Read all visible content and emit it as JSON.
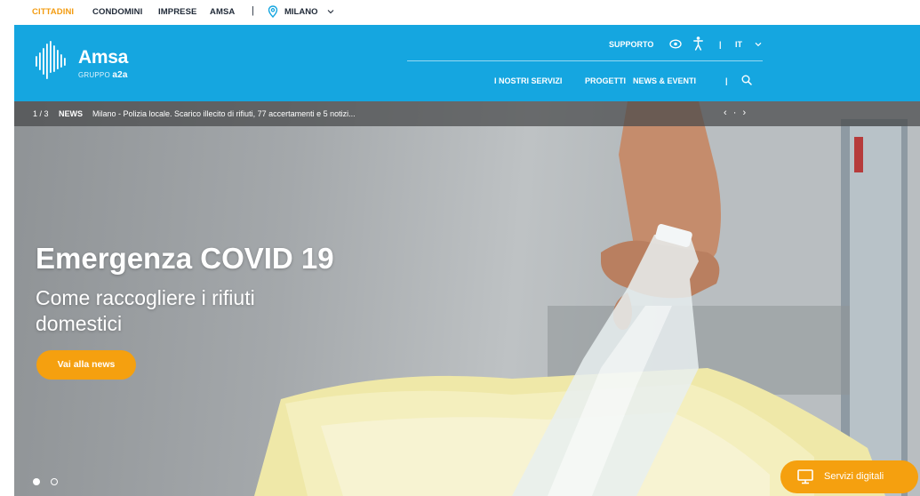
{
  "utility_nav": {
    "items": [
      {
        "label": "CITTADINI",
        "active": true
      },
      {
        "label": "CONDOMINI",
        "active": false
      },
      {
        "label": "IMPRESE",
        "active": false
      },
      {
        "label": "AMSA",
        "active": false
      }
    ],
    "separator": "|",
    "city": "MILANO"
  },
  "header": {
    "logo_word": "Amsa",
    "logo_sub_prefix": "GRUPPO",
    "logo_sub_brand": "a2a",
    "support_label": "SUPPORTO",
    "separator": "|",
    "language": "IT",
    "nav": [
      "I NOSTRI SERVIZI",
      "PROGETTI",
      "NEWS & EVENTI"
    ]
  },
  "news_ticker": {
    "counter": "1 / 3",
    "tag": "NEWS",
    "text": "Milano - Polizia locale. Scarico illecito di rifiuti, 77 accertamenti e 5 notizi...",
    "arrows": "‹ · ›"
  },
  "hero": {
    "title": "Emergenza COVID 19",
    "subtitle": "Come raccogliere i rifiuti domestici",
    "cta_label": "Vai alla news"
  },
  "floating_button": {
    "label": "Servizi digitali"
  },
  "colors": {
    "brand_blue": "#15a6e0",
    "accent_orange": "#f5a00f",
    "active_nav": "#f39c12"
  }
}
